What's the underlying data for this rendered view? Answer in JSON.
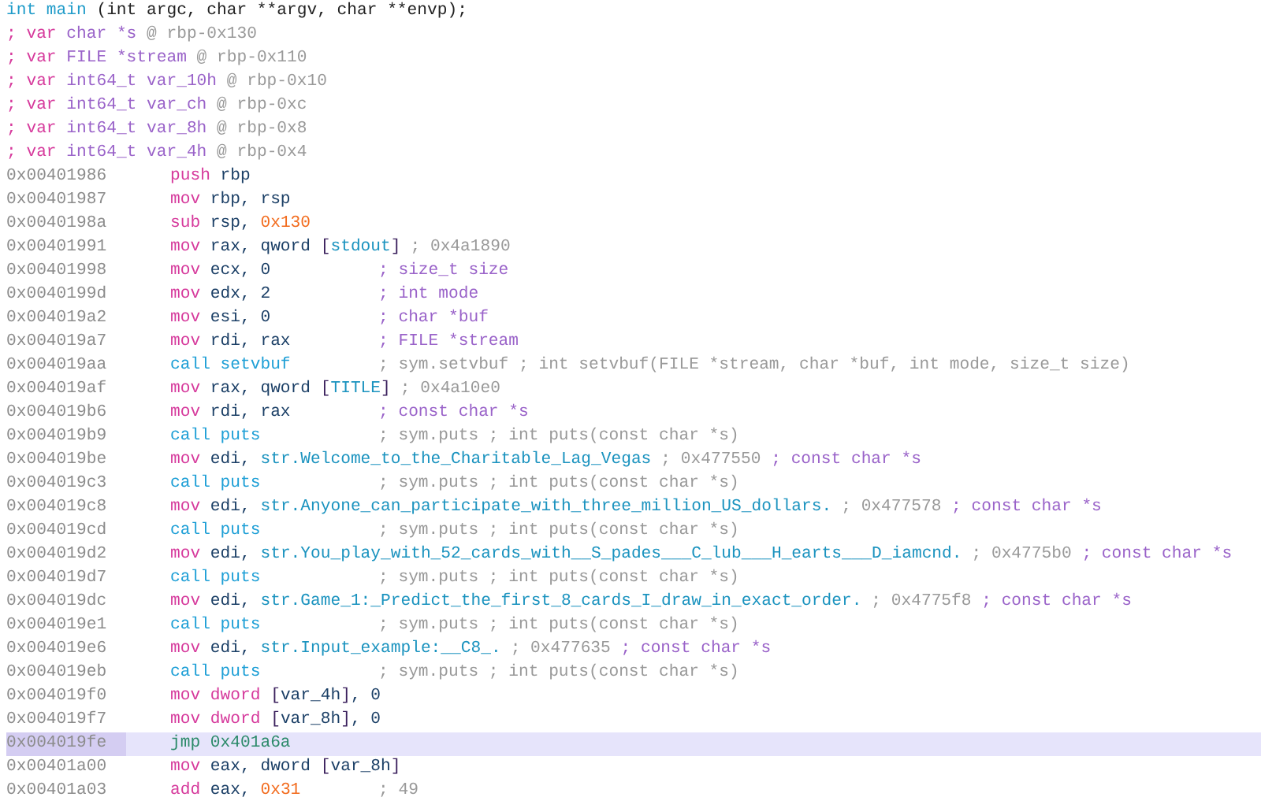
{
  "signature": [
    {
      "text": "int main",
      "kind": "type"
    },
    {
      "text": " (int argc, char **argv, char **envp);",
      "kind": "plain"
    }
  ],
  "variables": [
    [
      {
        "text": "; var ",
        "kind": "keyword"
      },
      {
        "text": "char *s",
        "kind": "annotation"
      },
      {
        "text": " @ rbp-0x130",
        "kind": "comment"
      }
    ],
    [
      {
        "text": "; var ",
        "kind": "keyword"
      },
      {
        "text": "FILE *stream",
        "kind": "annotation"
      },
      {
        "text": " @ rbp-0x110",
        "kind": "comment"
      }
    ],
    [
      {
        "text": "; var ",
        "kind": "keyword"
      },
      {
        "text": "int64_t var_10h",
        "kind": "annotation"
      },
      {
        "text": " @ rbp-0x10",
        "kind": "comment"
      }
    ],
    [
      {
        "text": "; var ",
        "kind": "keyword"
      },
      {
        "text": "int64_t var_ch",
        "kind": "annotation"
      },
      {
        "text": " @ rbp-0xc",
        "kind": "comment"
      }
    ],
    [
      {
        "text": "; var ",
        "kind": "keyword"
      },
      {
        "text": "int64_t var_8h",
        "kind": "annotation"
      },
      {
        "text": " @ rbp-0x8",
        "kind": "comment"
      }
    ],
    [
      {
        "text": "; var ",
        "kind": "keyword"
      },
      {
        "text": "int64_t var_4h",
        "kind": "annotation"
      },
      {
        "text": " @ rbp-0x4",
        "kind": "comment"
      }
    ]
  ],
  "instructions": [
    {
      "address": "0x00401986",
      "selected": false,
      "code": [
        {
          "text": "push",
          "kind": "keyword"
        },
        {
          "text": " rbp",
          "kind": "register"
        }
      ]
    },
    {
      "address": "0x00401987",
      "selected": false,
      "code": [
        {
          "text": "mov",
          "kind": "keyword"
        },
        {
          "text": " rbp, rsp",
          "kind": "register"
        }
      ]
    },
    {
      "address": "0x0040198a",
      "selected": false,
      "code": [
        {
          "text": "sub",
          "kind": "keyword"
        },
        {
          "text": " rsp, ",
          "kind": "register"
        },
        {
          "text": "0x130",
          "kind": "number"
        }
      ]
    },
    {
      "address": "0x00401991",
      "selected": false,
      "code": [
        {
          "text": "mov",
          "kind": "keyword"
        },
        {
          "text": " rax, qword ",
          "kind": "register"
        },
        {
          "text": "[",
          "kind": "bracket"
        },
        {
          "text": "stdout",
          "kind": "string"
        },
        {
          "text": "]",
          "kind": "bracket"
        }
      ],
      "comment": [
        {
          "text": "; 0x4a1890",
          "kind": "comment"
        }
      ]
    },
    {
      "address": "0x00401998",
      "selected": false,
      "code": [
        {
          "text": "mov",
          "kind": "keyword"
        },
        {
          "text": " ecx, 0",
          "kind": "register"
        }
      ],
      "comment": [
        {
          "text": "; size_t size",
          "kind": "annotation"
        }
      ]
    },
    {
      "address": "0x0040199d",
      "selected": false,
      "code": [
        {
          "text": "mov",
          "kind": "keyword"
        },
        {
          "text": " edx, 2",
          "kind": "register"
        }
      ],
      "comment": [
        {
          "text": "; int mode",
          "kind": "annotation"
        }
      ]
    },
    {
      "address": "0x004019a2",
      "selected": false,
      "code": [
        {
          "text": "mov",
          "kind": "keyword"
        },
        {
          "text": " esi, 0",
          "kind": "register"
        }
      ],
      "comment": [
        {
          "text": "; char *buf",
          "kind": "annotation"
        }
      ]
    },
    {
      "address": "0x004019a7",
      "selected": false,
      "code": [
        {
          "text": "mov",
          "kind": "keyword"
        },
        {
          "text": " rdi, rax",
          "kind": "register"
        }
      ],
      "comment": [
        {
          "text": "; FILE *stream",
          "kind": "annotation"
        }
      ]
    },
    {
      "address": "0x004019aa",
      "selected": false,
      "code": [
        {
          "text": "call setvbuf",
          "kind": "call"
        }
      ],
      "comment": [
        {
          "text": "; sym.setvbuf ; int setvbuf(FILE *stream, char *buf, int mode, size_t size)",
          "kind": "comment"
        }
      ]
    },
    {
      "address": "0x004019af",
      "selected": false,
      "code": [
        {
          "text": "mov",
          "kind": "keyword"
        },
        {
          "text": " rax, qword ",
          "kind": "register"
        },
        {
          "text": "[",
          "kind": "bracket"
        },
        {
          "text": "TITLE",
          "kind": "string"
        },
        {
          "text": "]",
          "kind": "bracket"
        }
      ],
      "comment": [
        {
          "text": "; 0x4a10e0",
          "kind": "comment"
        }
      ]
    },
    {
      "address": "0x004019b6",
      "selected": false,
      "code": [
        {
          "text": "mov",
          "kind": "keyword"
        },
        {
          "text": " rdi, rax",
          "kind": "register"
        }
      ],
      "comment": [
        {
          "text": "; const char *s",
          "kind": "annotation"
        }
      ]
    },
    {
      "address": "0x004019b9",
      "selected": false,
      "code": [
        {
          "text": "call puts",
          "kind": "call"
        }
      ],
      "comment": [
        {
          "text": "; sym.puts ; int puts(const char *s)",
          "kind": "comment"
        }
      ]
    },
    {
      "address": "0x004019be",
      "selected": false,
      "code": [
        {
          "text": "mov",
          "kind": "keyword"
        },
        {
          "text": " edi, ",
          "kind": "register"
        },
        {
          "text": "str.Welcome_to_the_Charitable_Lag_Vegas",
          "kind": "string"
        }
      ],
      "comment": [
        {
          "text": "; 0x477550 ",
          "kind": "comment"
        },
        {
          "text": "; const char *s",
          "kind": "annotation"
        }
      ]
    },
    {
      "address": "0x004019c3",
      "selected": false,
      "code": [
        {
          "text": "call puts",
          "kind": "call"
        }
      ],
      "comment": [
        {
          "text": "; sym.puts ; int puts(const char *s)",
          "kind": "comment"
        }
      ]
    },
    {
      "address": "0x004019c8",
      "selected": false,
      "code": [
        {
          "text": "mov",
          "kind": "keyword"
        },
        {
          "text": " edi, ",
          "kind": "register"
        },
        {
          "text": "str.Anyone_can_participate_with_three_million_US_dollars.",
          "kind": "string"
        }
      ],
      "comment": [
        {
          "text": "; 0x477578 ",
          "kind": "comment"
        },
        {
          "text": "; const char *s",
          "kind": "annotation"
        }
      ]
    },
    {
      "address": "0x004019cd",
      "selected": false,
      "code": [
        {
          "text": "call puts",
          "kind": "call"
        }
      ],
      "comment": [
        {
          "text": "; sym.puts ; int puts(const char *s)",
          "kind": "comment"
        }
      ]
    },
    {
      "address": "0x004019d2",
      "selected": false,
      "code": [
        {
          "text": "mov",
          "kind": "keyword"
        },
        {
          "text": " edi, ",
          "kind": "register"
        },
        {
          "text": "str.You_play_with_52_cards_with__S_pades___C_lub___H_earts___D_iamcnd.",
          "kind": "string"
        }
      ],
      "comment": [
        {
          "text": "; 0x4775b0 ",
          "kind": "comment"
        },
        {
          "text": "; const char *s",
          "kind": "annotation"
        }
      ]
    },
    {
      "address": "0x004019d7",
      "selected": false,
      "code": [
        {
          "text": "call puts",
          "kind": "call"
        }
      ],
      "comment": [
        {
          "text": "; sym.puts ; int puts(const char *s)",
          "kind": "comment"
        }
      ]
    },
    {
      "address": "0x004019dc",
      "selected": false,
      "code": [
        {
          "text": "mov",
          "kind": "keyword"
        },
        {
          "text": " edi, ",
          "kind": "register"
        },
        {
          "text": "str.Game_1:_Predict_the_first_8_cards_I_draw_in_exact_order.",
          "kind": "string"
        }
      ],
      "comment": [
        {
          "text": "; 0x4775f8 ",
          "kind": "comment"
        },
        {
          "text": "; const char *s",
          "kind": "annotation"
        }
      ]
    },
    {
      "address": "0x004019e1",
      "selected": false,
      "code": [
        {
          "text": "call puts",
          "kind": "call"
        }
      ],
      "comment": [
        {
          "text": "; sym.puts ; int puts(const char *s)",
          "kind": "comment"
        }
      ]
    },
    {
      "address": "0x004019e6",
      "selected": false,
      "code": [
        {
          "text": "mov",
          "kind": "keyword"
        },
        {
          "text": " edi, ",
          "kind": "register"
        },
        {
          "text": "str.Input_example:__C8_.",
          "kind": "string"
        }
      ],
      "comment": [
        {
          "text": "; 0x477635 ",
          "kind": "comment"
        },
        {
          "text": "; const char *s",
          "kind": "annotation"
        }
      ]
    },
    {
      "address": "0x004019eb",
      "selected": false,
      "code": [
        {
          "text": "call puts",
          "kind": "call"
        }
      ],
      "comment": [
        {
          "text": "; sym.puts ; int puts(const char *s)",
          "kind": "comment"
        }
      ]
    },
    {
      "address": "0x004019f0",
      "selected": false,
      "code": [
        {
          "text": "mov dword",
          "kind": "keyword"
        },
        {
          "text": " [",
          "kind": "bracket"
        },
        {
          "text": "var_4h",
          "kind": "register"
        },
        {
          "text": "]",
          "kind": "bracket"
        },
        {
          "text": ", 0",
          "kind": "register"
        }
      ]
    },
    {
      "address": "0x004019f7",
      "selected": false,
      "code": [
        {
          "text": "mov dword",
          "kind": "keyword"
        },
        {
          "text": " [",
          "kind": "bracket"
        },
        {
          "text": "var_8h",
          "kind": "register"
        },
        {
          "text": "]",
          "kind": "bracket"
        },
        {
          "text": ", 0",
          "kind": "register"
        }
      ]
    },
    {
      "address": "0x004019fe",
      "selected": true,
      "code": [
        {
          "text": "jmp 0x401a6a",
          "kind": "jump"
        }
      ]
    },
    {
      "address": "0x00401a00",
      "selected": false,
      "code": [
        {
          "text": "mov",
          "kind": "keyword"
        },
        {
          "text": " eax, dword ",
          "kind": "register"
        },
        {
          "text": "[",
          "kind": "bracket"
        },
        {
          "text": "var_8h",
          "kind": "register"
        },
        {
          "text": "]",
          "kind": "bracket"
        }
      ]
    },
    {
      "address": "0x00401a03",
      "selected": false,
      "code": [
        {
          "text": "add",
          "kind": "keyword"
        },
        {
          "text": " eax, ",
          "kind": "register"
        },
        {
          "text": "0x31",
          "kind": "number"
        }
      ],
      "comment": [
        {
          "text": "; 49",
          "kind": "comment"
        }
      ]
    }
  ]
}
